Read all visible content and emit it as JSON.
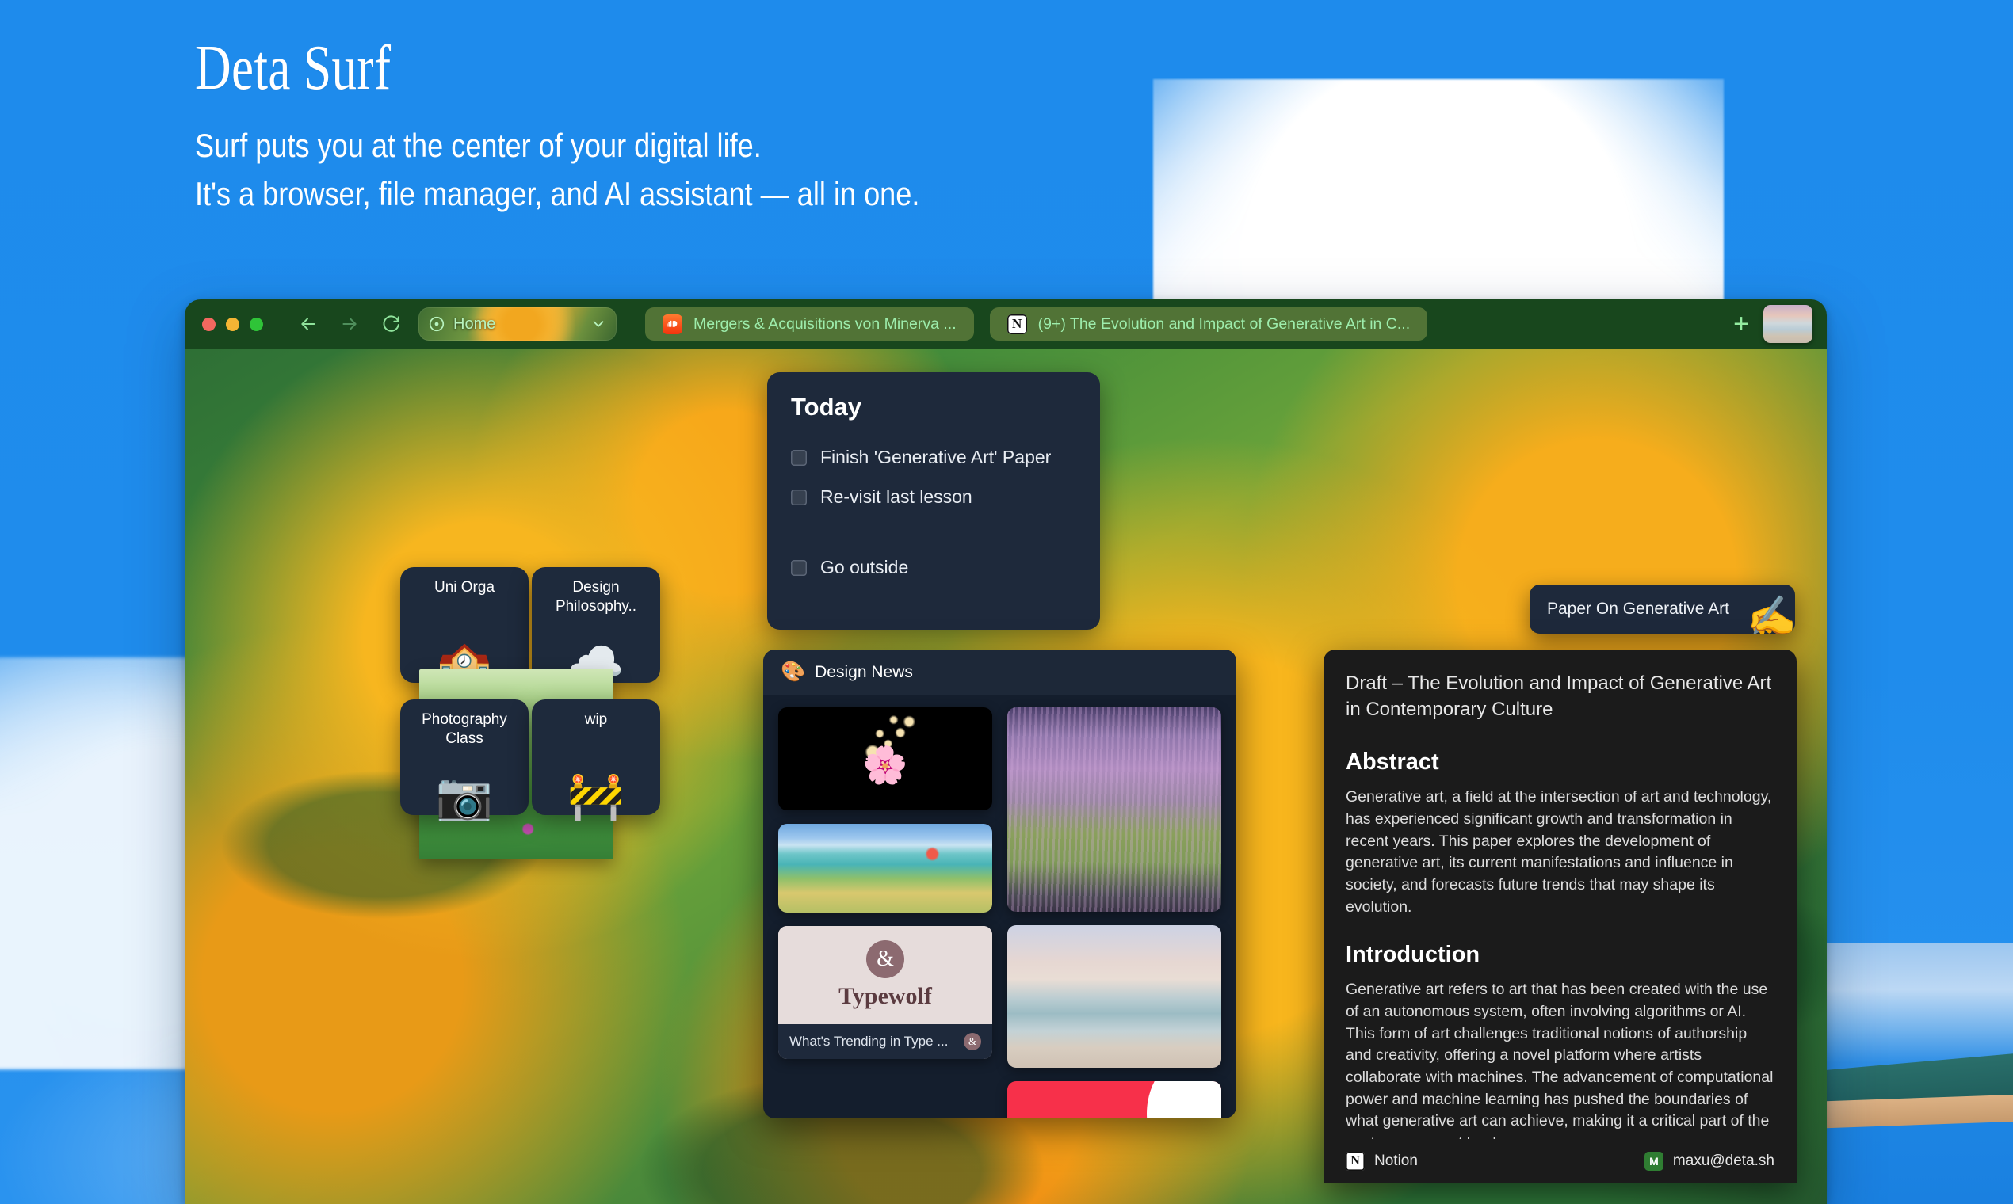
{
  "hero": {
    "title": "Deta Surf",
    "subtitle_line_1": "Surf puts you at the center of your digital life.",
    "subtitle_line_2": "It's a browser, file manager, and AI assistant — all in one."
  },
  "toolbar": {
    "back_label": "back-arrow",
    "forward_label": "forward-arrow",
    "reload_label": "reload",
    "home_chip_label": "Home",
    "home_chip_caret": "chevron-down-icon",
    "new_tab_label": "+",
    "tabs": [
      {
        "favicon": "soundcloud-icon",
        "label": "Mergers & Acquisitions von Minerva ..."
      },
      {
        "favicon": "notion-icon",
        "glyph": "N",
        "label": "(9+) The Evolution and Impact of Generative Art in C..."
      }
    ]
  },
  "tiles": [
    {
      "label": "Uni Orga",
      "emoji": "🏫"
    },
    {
      "label": "Design Philosophy..",
      "emoji": "☁️"
    },
    {
      "label": "Photography Class",
      "emoji": "📷"
    },
    {
      "label": "wip",
      "emoji": "🚧"
    }
  ],
  "today": {
    "title": "Today",
    "items": [
      {
        "label": "Finish 'Generative Art' Paper",
        "checked": false
      },
      {
        "label": "Re-visit last lesson",
        "checked": false
      },
      {
        "label": "Go outside",
        "checked": false
      }
    ]
  },
  "design_news": {
    "emoji": "🎨",
    "title": "Design News",
    "items": [
      {
        "name": "rose-animation-card",
        "caption": ""
      },
      {
        "name": "monet-cliff-walk-card",
        "caption": ""
      },
      {
        "name": "typewolf-card",
        "logo_glyph": "&",
        "brand": "Typewolf",
        "caption": "What's Trending in Type ...",
        "mini_glyph": "&"
      },
      {
        "name": "lavender-field-card",
        "caption": ""
      },
      {
        "name": "beach-sunset-card",
        "caption": ""
      },
      {
        "name": "red-card",
        "caption": ""
      }
    ]
  },
  "paper_pill": {
    "label": "Paper On Generative Art",
    "emoji": "✍️"
  },
  "document": {
    "title": "Draft – The Evolution and Impact of Generative Art in Contemporary Culture",
    "sections": [
      {
        "heading": "Abstract",
        "body": "Generative art, a field at the intersection of art and technology, has experienced significant growth and transformation in recent years. This paper explores the development of generative art, its current manifestations and influence in society, and forecasts future trends that may shape its evolution."
      },
      {
        "heading": "Introduction",
        "body": "Generative art refers to art that has been created with the use of an autonomous system, often involving algorithms or AI. This form of art challenges traditional notions of authorship and creativity, offering a novel platform where artists collaborate with machines. The advancement of computational power and machine learning has pushed the boundaries of what generative art can achieve, making it a critical part of the contemporary art landscape."
      }
    ],
    "footer": {
      "source_glyph": "N",
      "source_label": "Notion",
      "account_initial": "M",
      "account_label": "maxu@deta.sh"
    }
  },
  "colors": {
    "sky": "#1f8ceb",
    "toolbar": "#18471d",
    "tab_text": "#9dedac",
    "card_bg": "#1e293b",
    "doc_bg": "#1b1b1b",
    "accent_red": "#f7304a"
  }
}
